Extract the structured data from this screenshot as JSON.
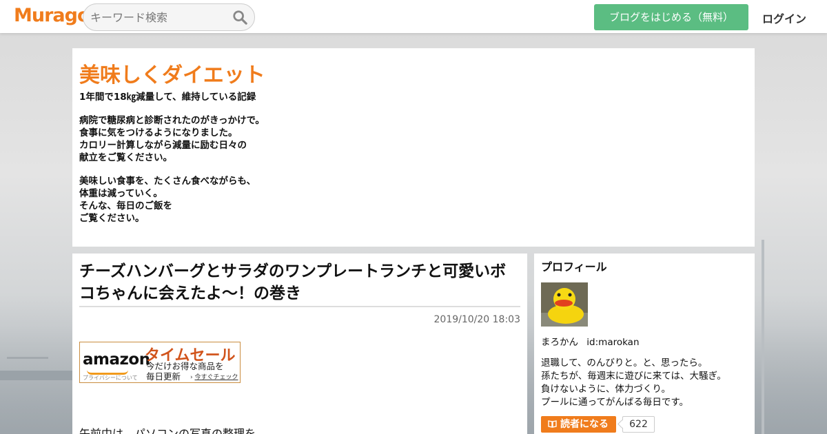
{
  "header": {
    "logo": "Muragon",
    "search_placeholder": "キーワード検索",
    "start_blog_label": "ブログをはじめる（無料）",
    "login_label": "ログイン"
  },
  "blog": {
    "title": "美味しくダイエット",
    "desc": [
      "1年間で18㎏減量して、維持している記録",
      "病院で糖尿病と診断されたのがきっかけで。\n食事に気をつけるようになりました。\nカロリー計算しながら減量に励む日々の\n献立をご覧ください。",
      "美味しい食事を、たくさん食べながらも、\n体重は減っていく。\nそんな、毎日のご飯を\nご覧ください。"
    ]
  },
  "article": {
    "title": "チーズハンバーグとサラダのワンプレートランチと可愛いボコちゃんに会えたよ～！の巻き",
    "date": "2019/10/20 18:03",
    "ad": {
      "brand": "amazon",
      "privacy": "プライバシーについて",
      "sale": "タイムセール",
      "sub": "今だけお得な商品を\n毎日更新",
      "check": "今すぐチェック"
    },
    "body_start": "午前中は、パソコンの写真の整理を"
  },
  "sidebar": {
    "title": "プロフィール",
    "name": "まろかん",
    "id": "id:marokan",
    "bio": "退職して、のんびりと。と、思ったら。\n孫たちが、毎週末に遊びに来ては、大騒ぎ。\n負けないように、体力づくり。\nプールに通ってがんばる毎日です。",
    "follow_label": "読者になる",
    "follow_count": "622"
  },
  "colors": {
    "accent": "#f07c1c",
    "green": "#5bbd82"
  }
}
